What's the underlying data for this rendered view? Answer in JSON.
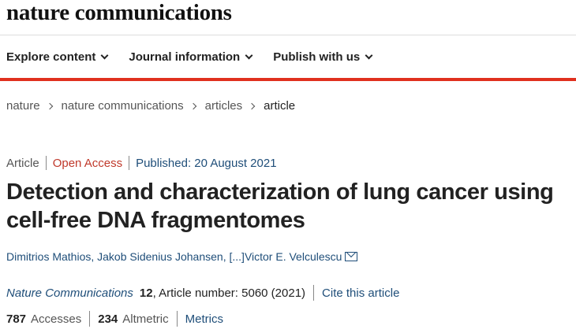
{
  "site": {
    "logo": "nature communications"
  },
  "nav": {
    "items": [
      {
        "label": "Explore content"
      },
      {
        "label": "Journal information"
      },
      {
        "label": "Publish with us"
      }
    ]
  },
  "breadcrumb": {
    "items": [
      "nature",
      "nature communications",
      "articles",
      "article"
    ]
  },
  "article": {
    "type": "Article",
    "access": "Open Access",
    "published": "Published: 20 August 2021",
    "title_line1": "Detection and characterization of lung cancer using",
    "title_line2": "cell-free DNA fragmentomes",
    "authors": {
      "author1": "Dimitrios Mathios",
      "comma1": ", ",
      "author2": "Jakob Sidenius Johansen",
      "comma2": ", ",
      "ellipsis": "[...]",
      "author_last": "Victor E. Velculescu"
    },
    "citation": {
      "journal": "Nature Communications",
      "volume": "12",
      "article_number": ", Article number: 5060 (2021)",
      "cite_link": "Cite this article"
    },
    "metrics": {
      "accesses_count": "787",
      "accesses_label": "Accesses",
      "altmetric_count": "234",
      "altmetric_label": "Altmetric",
      "metrics_link": "Metrics"
    }
  },
  "colors": {
    "accent_red": "#e0301e",
    "link_blue": "#1f4e79",
    "open_access": "#c0392b"
  }
}
